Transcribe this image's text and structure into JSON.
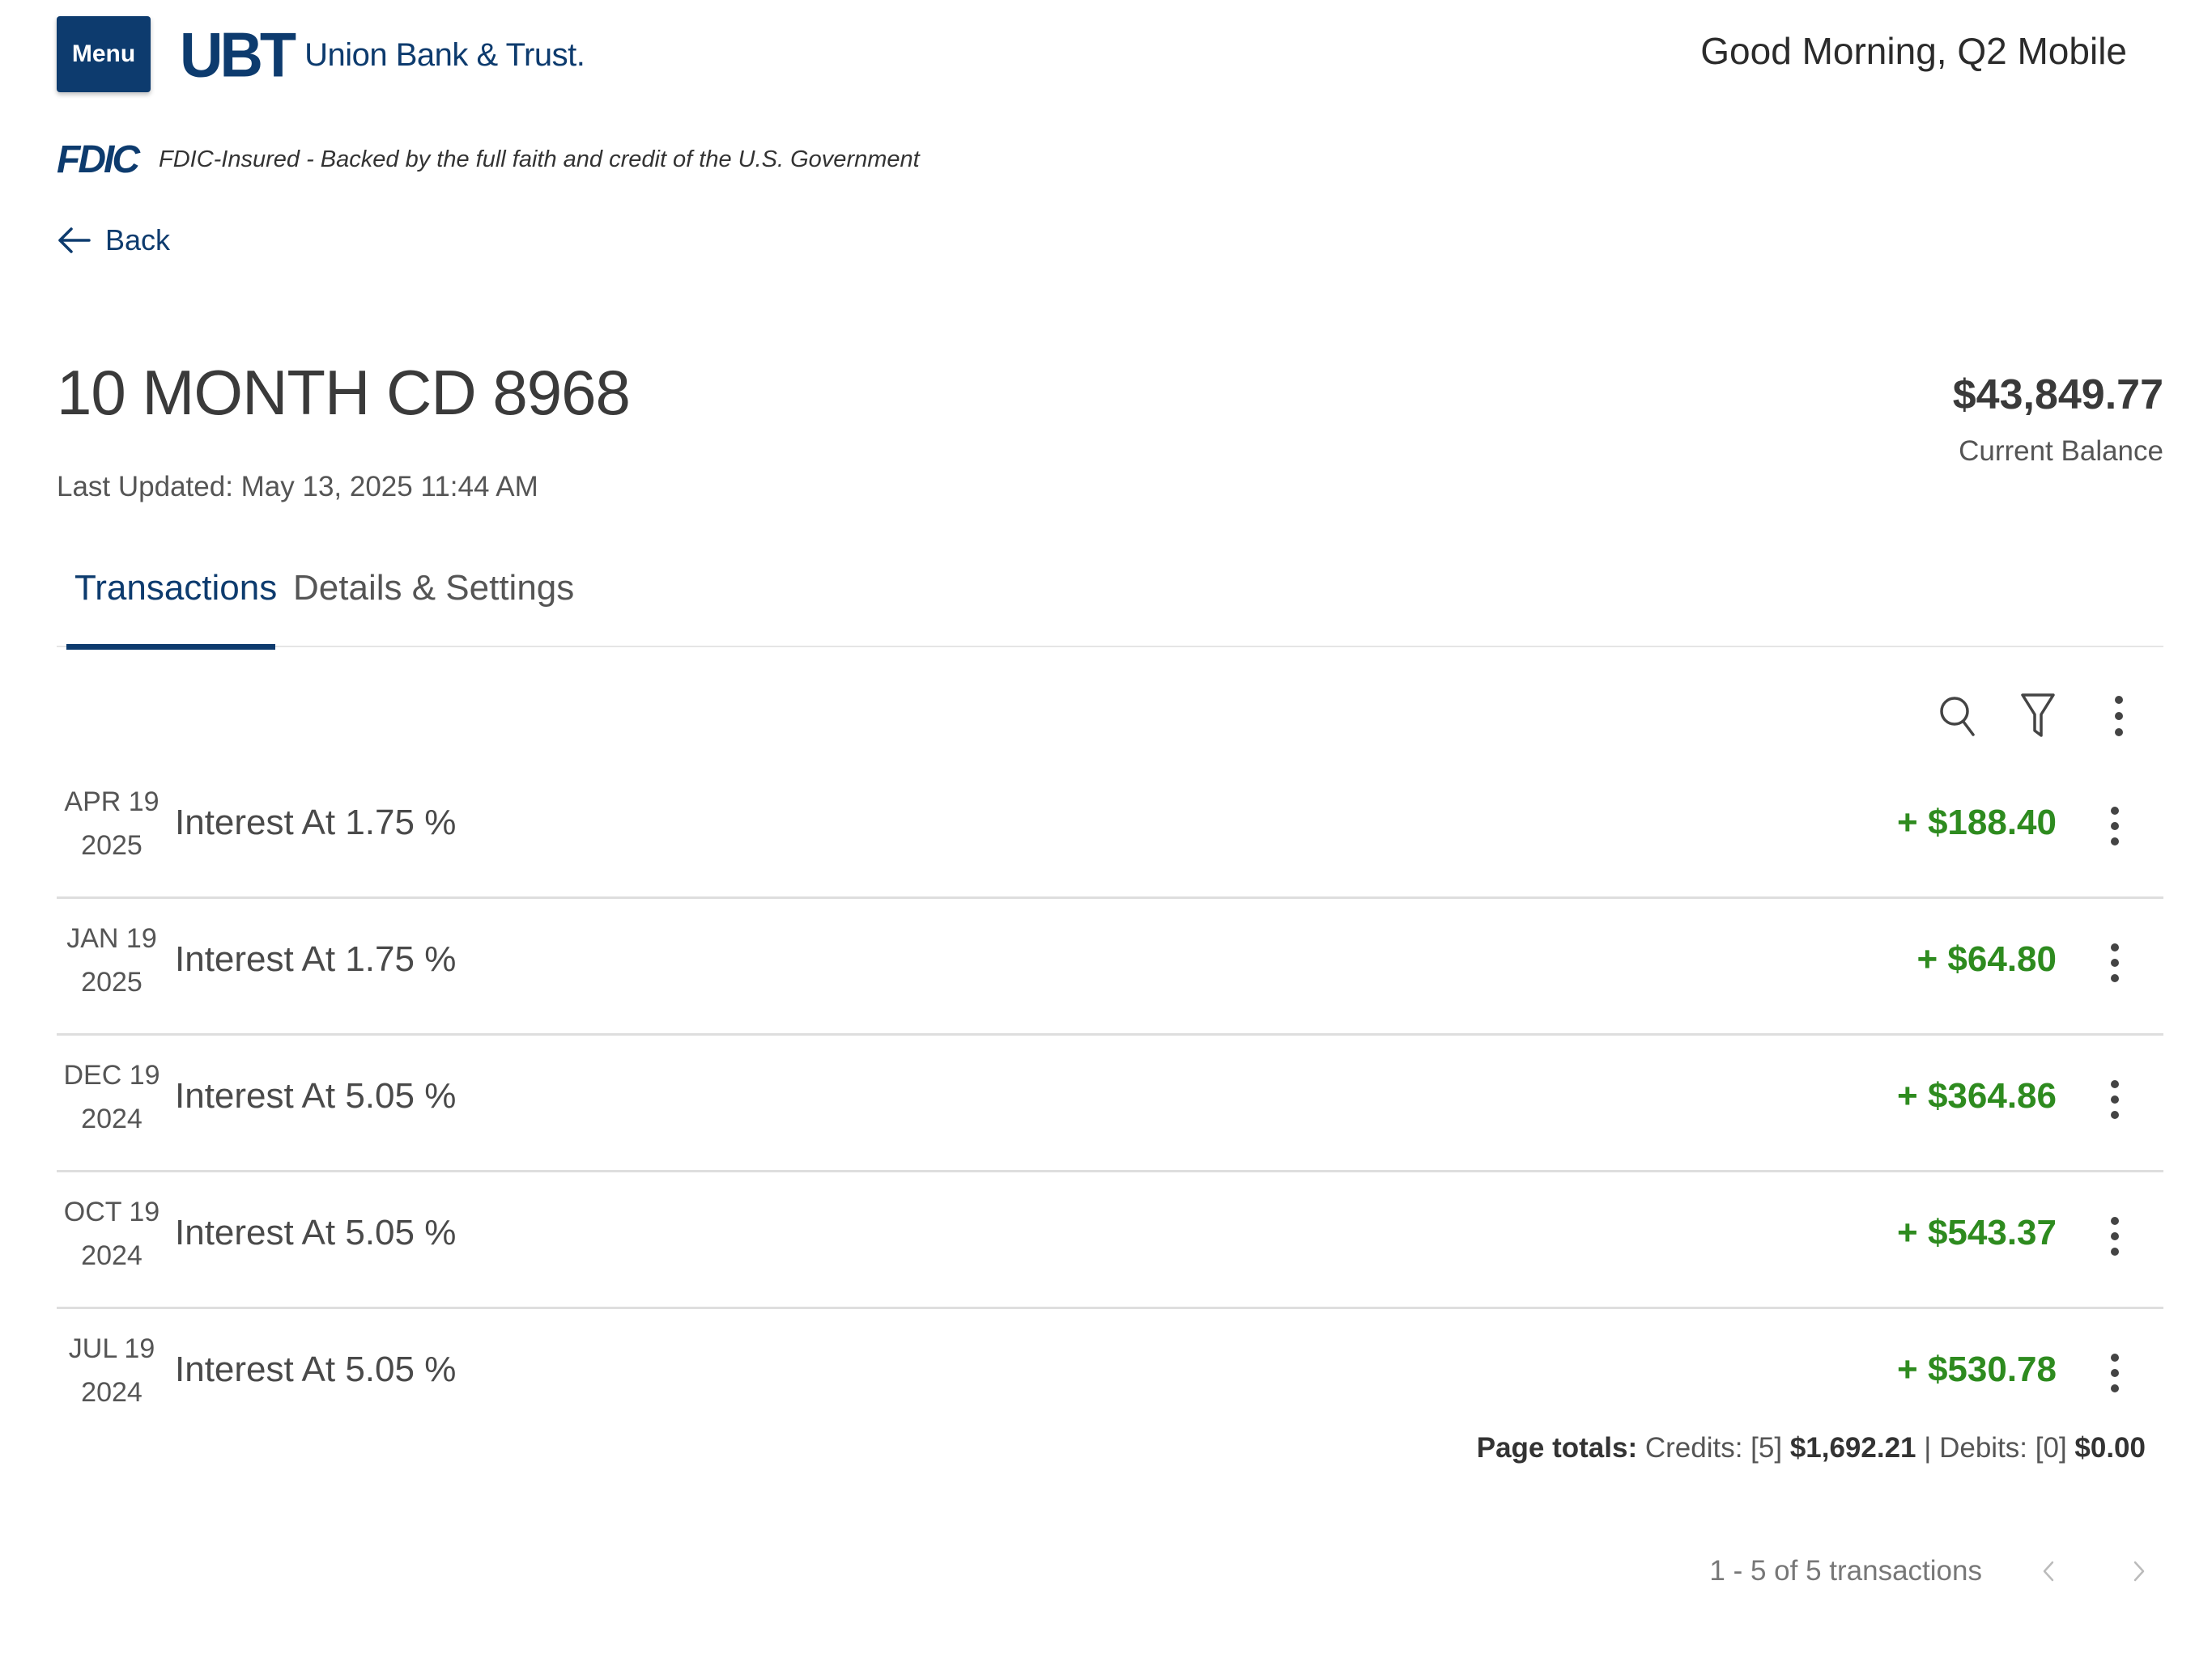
{
  "header": {
    "menu_label": "Menu",
    "logo_mark": "UBT",
    "logo_text": "Union Bank & Trust.",
    "greeting": "Good Morning, Q2 Mobile"
  },
  "fdic": {
    "logo": "FDIC",
    "text": "FDIC-Insured - Backed by the full faith and credit of the U.S. Government"
  },
  "nav": {
    "back_label": "Back"
  },
  "account": {
    "title": "10 MONTH CD 8968",
    "last_updated": "Last Updated: May 13, 2025 11:44 AM",
    "balance": "$43,849.77",
    "balance_label": "Current Balance"
  },
  "tabs": [
    {
      "label": "Transactions",
      "active": true
    },
    {
      "label": "Details & Settings",
      "active": false
    }
  ],
  "toolbar": {
    "icons": [
      "search-icon",
      "filter-icon",
      "more-vertical-icon"
    ]
  },
  "transactions": [
    {
      "date_md": "APR 19",
      "date_y": "2025",
      "description": "Interest At 1.75 %",
      "amount": "+ $188.40"
    },
    {
      "date_md": "JAN 19",
      "date_y": "2025",
      "description": "Interest At 1.75 %",
      "amount": "+ $64.80"
    },
    {
      "date_md": "DEC 19",
      "date_y": "2024",
      "description": "Interest At 5.05 %",
      "amount": "+ $364.86"
    },
    {
      "date_md": "OCT 19",
      "date_y": "2024",
      "description": "Interest At 5.05 %",
      "amount": "+ $543.37"
    },
    {
      "date_md": "JUL 19",
      "date_y": "2024",
      "description": "Interest At 5.05 %",
      "amount": "+ $530.78"
    }
  ],
  "totals": {
    "label": "Page totals:",
    "credits_label": "Credits: [5]",
    "credits_value": "$1,692.21",
    "separator": "|",
    "debits_label": "Debits: [0]",
    "debits_value": "$0.00"
  },
  "pagination": {
    "summary": "1 - 5 of 5 transactions"
  },
  "colors": {
    "brand": "#0d3b6e",
    "credit": "#2e8b1f",
    "divider": "#dedede"
  }
}
